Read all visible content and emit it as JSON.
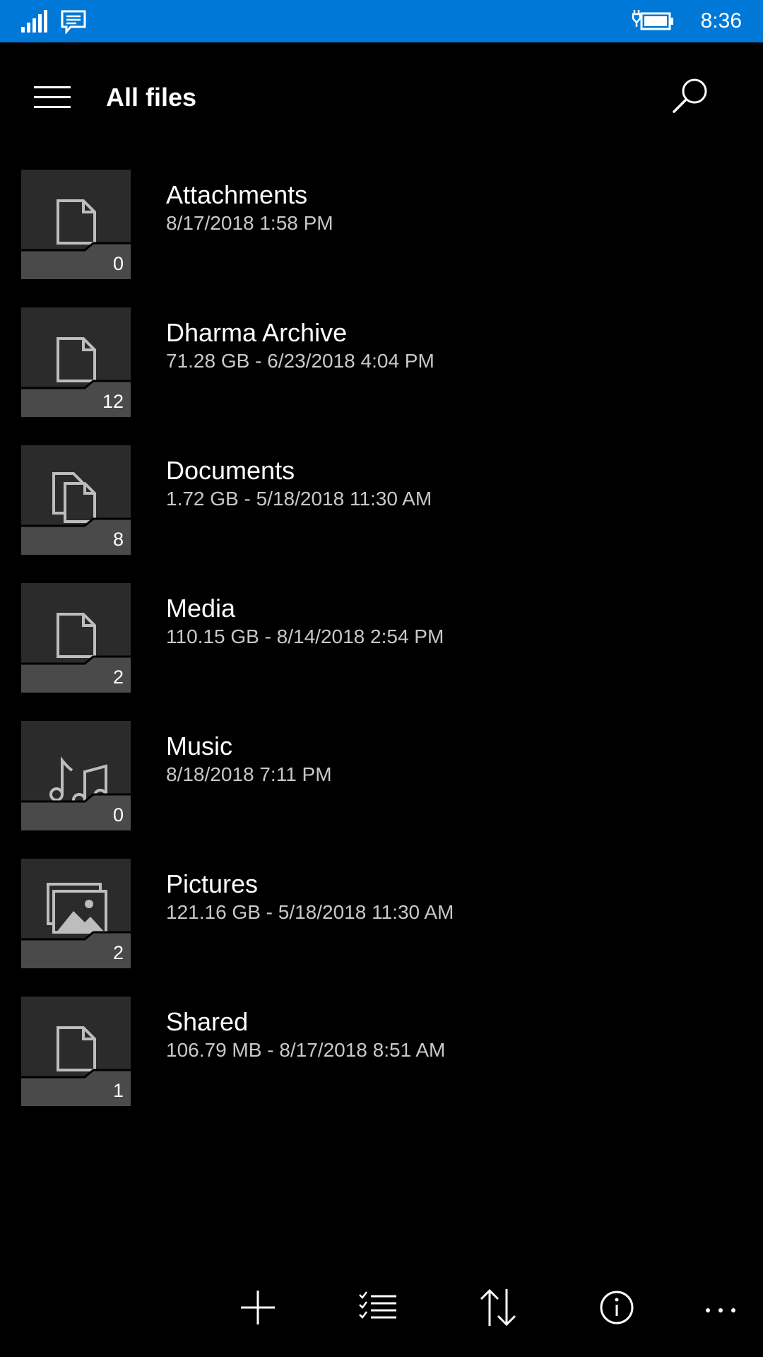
{
  "status_bar": {
    "time": "8:36"
  },
  "header": {
    "title": "All files"
  },
  "items": [
    {
      "name": "Attachments",
      "meta": "8/17/2018 1:58 PM",
      "count": "0",
      "icon": "file-icon"
    },
    {
      "name": "Dharma Archive",
      "meta": "71.28 GB - 6/23/2018 4:04 PM",
      "count": "12",
      "icon": "file-icon"
    },
    {
      "name": "Documents",
      "meta": "1.72 GB - 5/18/2018 11:30 AM",
      "count": "8",
      "icon": "documents-icon"
    },
    {
      "name": "Media",
      "meta": "110.15 GB - 8/14/2018 2:54 PM",
      "count": "2",
      "icon": "file-icon"
    },
    {
      "name": "Music",
      "meta": "8/18/2018 7:11 PM",
      "count": "0",
      "icon": "music-icon"
    },
    {
      "name": "Pictures",
      "meta": "121.16 GB - 5/18/2018 11:30 AM",
      "count": "2",
      "icon": "pictures-icon"
    },
    {
      "name": "Shared",
      "meta": "106.79 MB - 8/17/2018 8:51 AM",
      "count": "1",
      "icon": "file-icon"
    }
  ],
  "app_bar": {
    "buttons": [
      "add-icon",
      "select-icon",
      "sort-icon",
      "info-icon",
      "more-icon"
    ]
  }
}
